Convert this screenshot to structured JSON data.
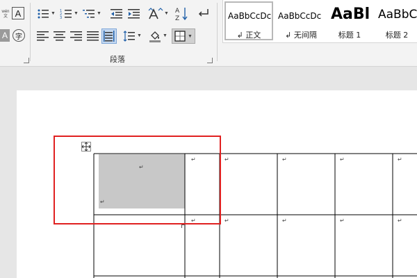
{
  "ribbon": {
    "group_label": "段落",
    "font_group": {
      "pinyin_top": "wén",
      "pinyin_bottom": "文",
      "char_border_label": "A",
      "char_shading_label": "A",
      "enclose_char_label": "字"
    },
    "icons": {
      "bullets": "bulleted-list-icon",
      "numbering": "numbered-list-icon",
      "multilevel": "multilevel-list-icon",
      "decrease_indent": "decrease-indent-icon",
      "increase_indent": "increase-indent-icon",
      "chinese_layout": "chinese-layout-icon",
      "sort": "sort-icon",
      "show_marks": "show-paragraph-marks-icon",
      "align_left": "align-left-icon",
      "align_center": "align-center-icon",
      "align_right": "align-right-icon",
      "justify": "justify-icon",
      "distributed": "distributed-icon",
      "line_spacing": "line-spacing-icon",
      "shading": "paint-bucket-icon",
      "borders": "borders-icon"
    }
  },
  "styles": [
    {
      "sample": "AaBbCcDc",
      "name": "↲ 正文",
      "selected": true
    },
    {
      "sample": "AaBbCcDc",
      "name": "↲ 无间隔",
      "selected": false
    },
    {
      "sample": "AaBl",
      "name": "标题 1",
      "selected": false
    },
    {
      "sample": "AaBbC",
      "name": "标题 2",
      "selected": false
    }
  ],
  "document": {
    "cell_mark": "↵",
    "table_move_handle": "move-handle-icon"
  },
  "colors": {
    "highlight_box": "#e02020",
    "cell_shading": "#c8c8c8",
    "ribbon_bg": "#f3f3f3",
    "canvas_bg": "#e6e6e6"
  }
}
